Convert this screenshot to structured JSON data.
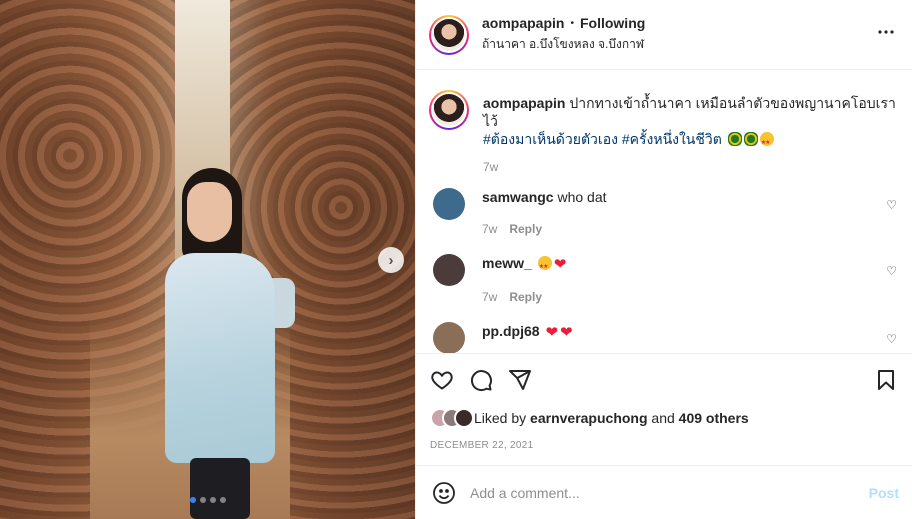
{
  "media": {
    "carousel": {
      "total": 4,
      "active_index": 0
    },
    "next_icon": "chevron-right-icon"
  },
  "header": {
    "username": "aompapapin",
    "separator": "•",
    "follow_status": "Following",
    "location": "ถ้านาคา อ.บึงโขงหลง จ.บึงกาฬ",
    "more_icon": "ellipsis-icon",
    "more_label": "..."
  },
  "caption": {
    "username": "aompapapin",
    "text": "ปากทางเข้าถ้ำนาคา เหมือนลำตัวของพญานาคโอบเราไว้",
    "hashtags": [
      "#ต้องมาเห็นด้วยตัวเอง",
      "#ครั้งหนึ่งในชีวิต"
    ],
    "emojis": [
      "snake-emoji",
      "snake-emoji",
      "star-struck-emoji"
    ],
    "time": "7w"
  },
  "comments": [
    {
      "username": "samwangc",
      "text": "who dat",
      "emojis": [],
      "time": "7w",
      "reply_label": "Reply",
      "avatar_color": "#3e6a8c"
    },
    {
      "username": "meww_",
      "text": "",
      "emojis": [
        "star-struck-emoji",
        "red-heart-emoji"
      ],
      "time": "7w",
      "reply_label": "Reply",
      "avatar_color": "#4b3b3b"
    },
    {
      "username": "pp.dpj68",
      "text": "",
      "emojis": [
        "red-heart-emoji",
        "red-heart-emoji"
      ],
      "time": "",
      "reply_label": "",
      "avatar_color": "#8a6e58"
    }
  ],
  "heart_glyph": "❤",
  "like_glyph": "♡",
  "actions": {
    "icons": [
      "heart-icon",
      "comment-icon",
      "share-icon",
      "bookmark-icon"
    ]
  },
  "likes": {
    "prefix": "Liked by",
    "user": "earnverapuchong",
    "middle": "and",
    "others": "409 others",
    "avatar_colors": [
      "#c9a3a8",
      "#8a7a7a",
      "#3a2b2b"
    ]
  },
  "date": "DECEMBER 22, 2021",
  "add_comment": {
    "placeholder": "Add a comment...",
    "post_label": "Post",
    "emoji_icon": "smiley-icon"
  },
  "colors": {
    "hashtag": "#00376b",
    "post_button": "#b2dffc",
    "carousel_active": "#3b82f6"
  }
}
